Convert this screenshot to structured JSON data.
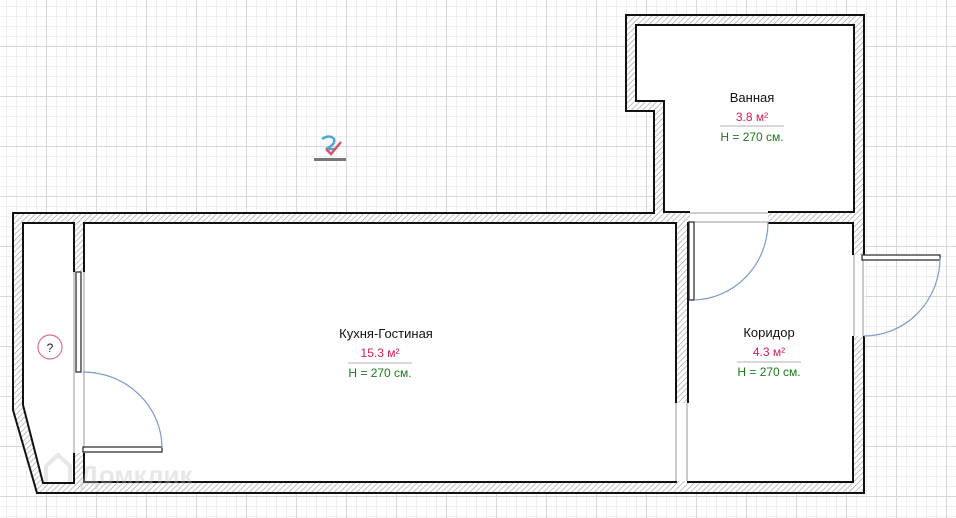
{
  "rooms": [
    {
      "name": "Кухня-Гостиная",
      "area": "15.3 м²",
      "height": "H = 270 см."
    },
    {
      "name": "Ванная",
      "area": "3.8 м²",
      "height": "H = 270 см."
    },
    {
      "name": "Коридор",
      "area": "4.3 м²",
      "height": "H = 270 см."
    }
  ],
  "unknown_room": {
    "label": "?"
  },
  "watermark": "Домклик",
  "logo": {
    "icon": "replanning-logo-icon"
  },
  "colors": {
    "wall": "#111111",
    "area_text": "#d81b50",
    "height_text": "#1a7a1a",
    "door_arc": "#7a9ad0"
  }
}
